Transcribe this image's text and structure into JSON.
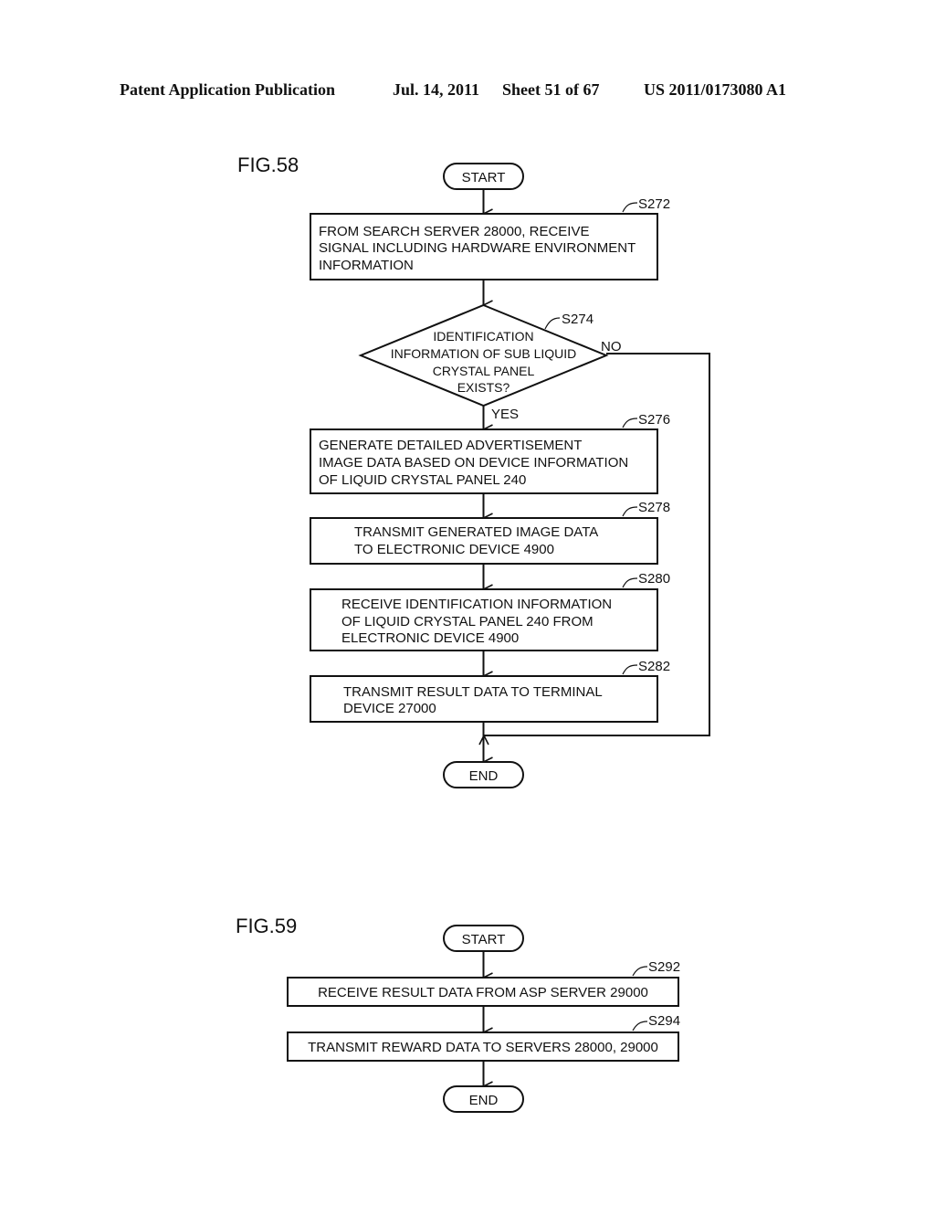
{
  "header": {
    "publication": "Patent Application Publication",
    "date": "Jul. 14, 2011",
    "sheet": "Sheet 51 of 67",
    "number": "US 2011/0173080 A1"
  },
  "fig58": {
    "label": "FIG.58",
    "start": "START",
    "end": "END",
    "steps": [
      {
        "id": "S272",
        "lines": [
          "FROM SEARCH SERVER 28000, RECEIVE",
          "SIGNAL INCLUDING HARDWARE ENVIRONMENT",
          "INFORMATION"
        ]
      },
      {
        "id": "S274",
        "lines": [
          "IDENTIFICATION",
          "INFORMATION OF SUB LIQUID",
          "CRYSTAL PANEL",
          "EXISTS?"
        ],
        "yes": "YES",
        "no": "NO"
      },
      {
        "id": "S276",
        "lines": [
          "GENERATE DETAILED ADVERTISEMENT",
          "IMAGE DATA BASED ON DEVICE INFORMATION",
          "OF LIQUID CRYSTAL PANEL 240"
        ]
      },
      {
        "id": "S278",
        "lines": [
          "TRANSMIT GENERATED IMAGE DATA",
          "TO ELECTRONIC DEVICE 4900"
        ]
      },
      {
        "id": "S280",
        "lines": [
          "RECEIVE IDENTIFICATION INFORMATION",
          "OF LIQUID CRYSTAL PANEL 240 FROM",
          "ELECTRONIC DEVICE 4900"
        ]
      },
      {
        "id": "S282",
        "lines": [
          "TRANSMIT RESULT DATA TO TERMINAL",
          "DEVICE 27000"
        ]
      }
    ]
  },
  "fig59": {
    "label": "FIG.59",
    "start": "START",
    "end": "END",
    "steps": [
      {
        "id": "S292",
        "lines": [
          "RECEIVE RESULT DATA FROM ASP SERVER 29000"
        ]
      },
      {
        "id": "S294",
        "lines": [
          "TRANSMIT REWARD DATA TO SERVERS 28000, 29000"
        ]
      }
    ]
  }
}
